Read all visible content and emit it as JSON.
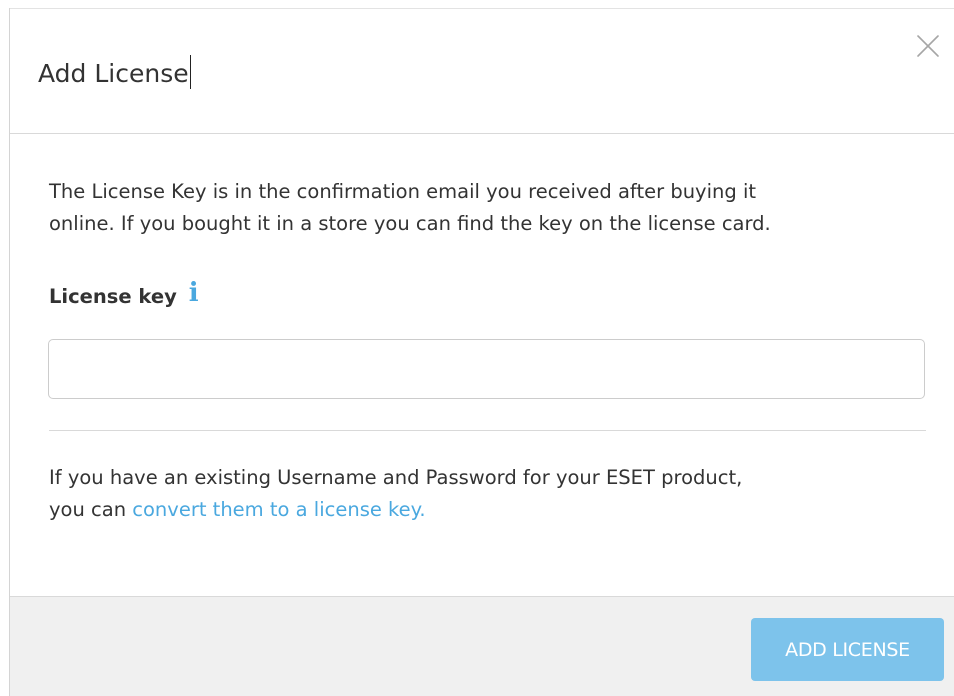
{
  "dialog": {
    "title": "Add License",
    "close_icon": "close-icon"
  },
  "body": {
    "description_line1": "The License Key is in the confirmation email you received after buying it",
    "description_line2": "online. If you bought it in a store you can find the key on the license card.",
    "license_key_label": "License key",
    "info_icon_glyph": "i",
    "license_key_value": "",
    "license_key_placeholder": "",
    "convert_line1": "If you have an existing Username and Password for your ESET product,",
    "convert_line2_prefix": "you can ",
    "convert_link_text": "convert them to a license key."
  },
  "footer": {
    "add_license_label": "ADD LICENSE"
  },
  "colors": {
    "accent": "#4aa8df",
    "button_bg": "#7dc3eb",
    "footer_bg": "#f0f0f0",
    "text": "#333333"
  }
}
